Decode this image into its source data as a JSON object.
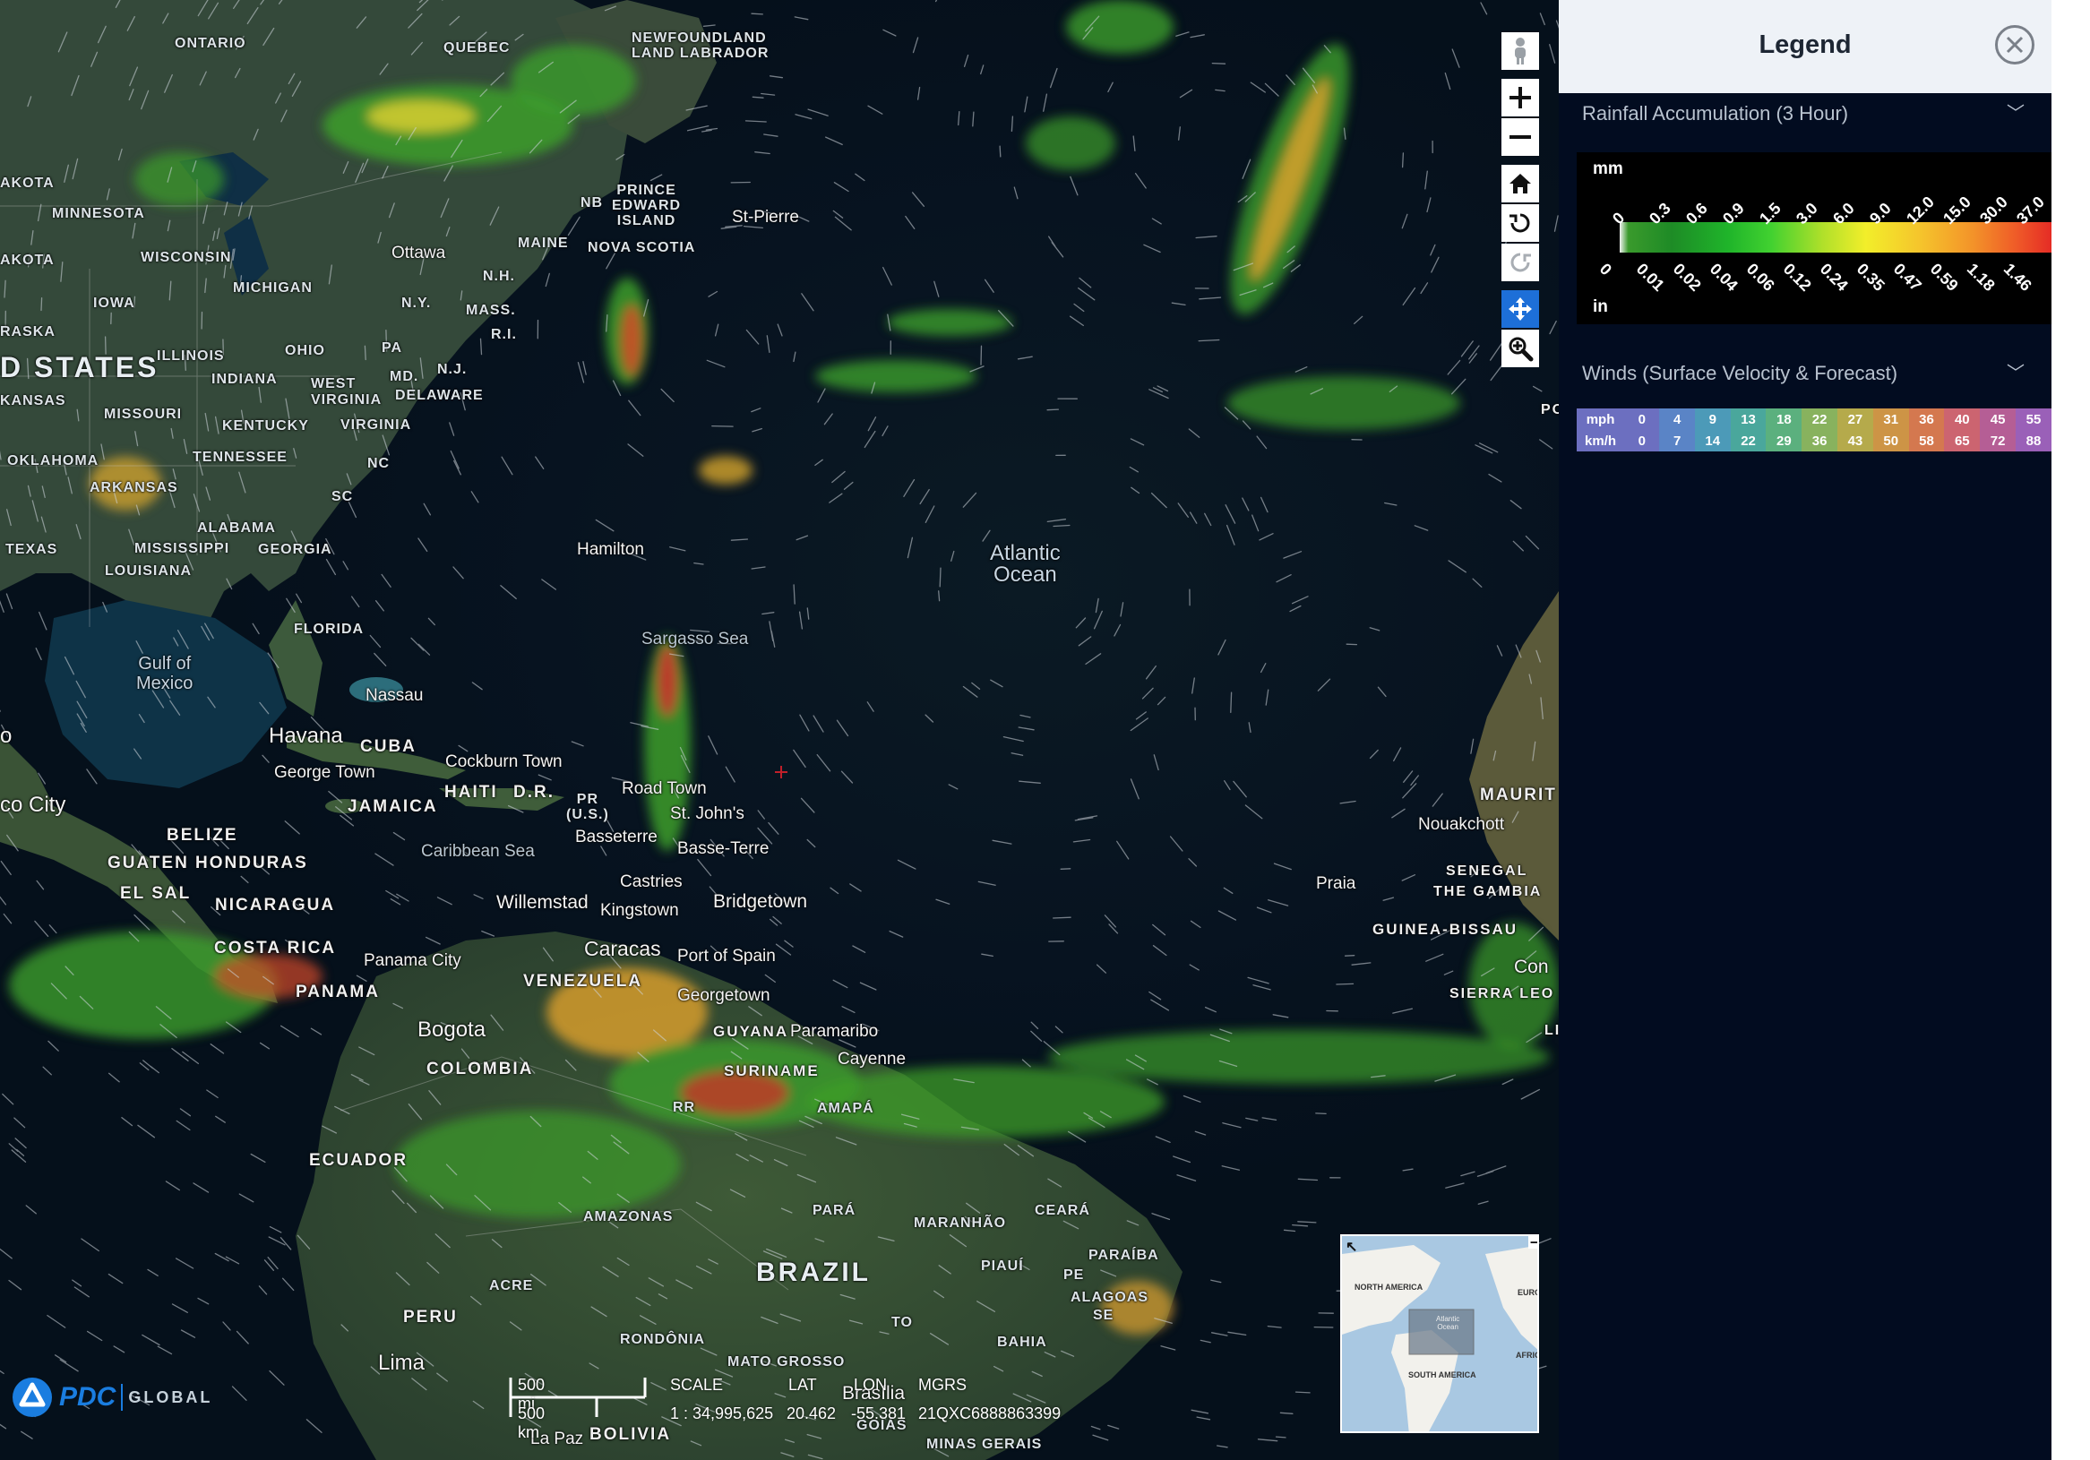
{
  "map": {
    "labels": {
      "ontario": "ONTARIO",
      "quebec": "QUEBEC",
      "newfoundland": "NEWFOUNDLAND\nLAND LABRADOR",
      "minnesota": "MINNESOTA",
      "dakota1": "AKOTA",
      "dakota2": "AKOTA",
      "wisconsin": "WISCONSIN",
      "michigan": "MICHIGAN",
      "iowa": "IOWA",
      "nebraska": "RASKA",
      "illinois": "ILLINOIS",
      "ohio": "OHIO",
      "pa": "PA",
      "ny": "N.Y.",
      "nh": "N.H.",
      "mass": "MASS.",
      "ri": "R.I.",
      "maine": "MAINE",
      "nb": "NB",
      "pei": "PRINCE\nEDWARD\nISLAND",
      "nova_scotia": "NOVA SCOTIA",
      "united_states": "D STATES",
      "kansas": "KANSAS",
      "missouri": "MISSOURI",
      "indiana": "INDIANA",
      "west_virginia": "WEST\nVIRGINIA",
      "md": "MD.",
      "nj": "N.J.",
      "delaware": "DELAWARE",
      "kentucky": "KENTUCKY",
      "virginia": "VIRGINIA",
      "oklahoma": "OKLAHOMA",
      "arkansas": "ARKANSAS",
      "tennessee": "TENNESSEE",
      "nc": "NC",
      "sc": "SC",
      "alabama": "ALABAMA",
      "mississippi": "MISSISSIPPI",
      "georgia": "GEORGIA",
      "texas": "TEXAS",
      "louisiana": "LOUISIANA",
      "florida": "FLORIDA",
      "cuba": "CUBA",
      "jamaica": "JAMAICA",
      "haiti": "HAITI",
      "dr": "D.R.",
      "pr": "PR\n(U.S.)",
      "belize": "BELIZE",
      "guatemala": "GUATEN",
      "honduras": "HONDURAS",
      "el_salvador": "EL SAL",
      "nicaragua": "NICARAGUA",
      "costa_rica": "COSTA RICA",
      "panama": "PANAMA",
      "venezuela": "VENEZUELA",
      "guyana": "GUYANA",
      "suriname": "SURINAME",
      "amapa": "AMAPÁ",
      "colombia": "COLOMBIA",
      "ecuador": "ECUADOR",
      "peru": "PERU",
      "brazil": "BRAZIL",
      "amazonas": "AMAZONAS",
      "rr": "RR",
      "para": "PARÁ",
      "maranhao": "MARANHÃO",
      "ceara": "CEARÁ",
      "piaui": "PIAUÍ",
      "paraiba": "PARAÍBA",
      "pe": "PE",
      "alagoas": "ALAGOAS",
      "se": "SE",
      "bahia": "BAHIA",
      "to": "TO",
      "acre": "ACRE",
      "rondonia": "RONDÔNIA",
      "mato_grosso": "MATO GROSSO",
      "goias": "GOIÁS",
      "minas_gerais": "MINAS GERAIS",
      "bolivia": "BOLIVIA",
      "mauritania": "MAURIT",
      "senegal": "SENEGAL",
      "gambia": "THE GAMBIA",
      "guinea_bissau": "GUINEA-BISSAU",
      "sierra_leone": "SIERRA LEO",
      "po": "PO",
      "li": "LI",
      "ottawa": "Ottawa",
      "st_pierre": "St-Pierre",
      "hamilton": "Hamilton",
      "nassau": "Nassau",
      "havana": "Havana",
      "george_town": "George Town",
      "cockburn_town": "Cockburn Town",
      "road_town": "Road Town",
      "st_johns": "St. John's",
      "basseterre": "Basseterre",
      "basse_terre": "Basse-Terre",
      "castries": "Castries",
      "willemstad": "Willemstad",
      "kingstown": "Kingstown",
      "bridgetown": "Bridgetown",
      "caracas": "Caracas",
      "port_of_spain": "Port of Spain",
      "georgetown": "Georgetown",
      "paramaribo": "Paramaribo",
      "cayenne": "Cayenne",
      "panama_city": "Panama City",
      "bogota": "Bogota",
      "lima": "Lima",
      "la_paz": "La Paz",
      "brasilia": "Brasília",
      "mexico_city": "co City",
      "nouakchott": "Nouakchott",
      "praia": "Praia",
      "conakry": "Con",
      "atlantic_ocean": "Atlantic\nOcean",
      "gulf_of_mexico": "Gulf of\nMexico",
      "caribbean_sea": "Caribbean Sea",
      "sargasso_sea": "Sargasso Sea",
      "o_edge": "o"
    },
    "minimap": {
      "north_america": "NORTH AMERICA",
      "south_america": "SOUTH AMERICA",
      "europe": "EUROP",
      "africa": "AFRIC",
      "atlantic": "Atlantic\nOcean"
    },
    "scalebar": {
      "top": "500 mi",
      "bottom": "500 km"
    },
    "coords": {
      "scale_label": "SCALE",
      "scale_value": "1 : 34,995,625",
      "lat_label": "LAT",
      "lat_value": "20.462",
      "lon_label": "LON",
      "lon_value": "-55.381",
      "mgrs_label": "MGRS",
      "mgrs_value": "21QXC6888863399"
    },
    "logo": {
      "brand": "PDC",
      "sub": "GLOBAL"
    }
  },
  "legend": {
    "title": "Legend",
    "rain": {
      "title": "Rainfall Accumulation (3 Hour)",
      "unit_top": "mm",
      "unit_bottom": "in",
      "mm_ticks": [
        "0",
        "0.3",
        "0.6",
        "0.9",
        "1.5",
        "3.0",
        "6.0",
        "9.0",
        "12.0",
        "15.0",
        "30.0",
        "37.0"
      ],
      "in_ticks": [
        "0",
        "0.01",
        "0.02",
        "0.04",
        "0.06",
        "0.12",
        "0.24",
        "0.35",
        "0.47",
        "0.59",
        "1.18",
        "1.46"
      ]
    },
    "wind": {
      "title": "Winds (Surface Velocity & Forecast)",
      "mph_label": "mph",
      "kmh_label": "km/h",
      "mph": [
        "0",
        "4",
        "9",
        "13",
        "18",
        "22",
        "27",
        "31",
        "36",
        "40",
        "45",
        "55"
      ],
      "kmh": [
        "0",
        "7",
        "14",
        "22",
        "29",
        "36",
        "43",
        "50",
        "58",
        "65",
        "72",
        "88"
      ],
      "colors": [
        "#6c6fc0",
        "#5a84c6",
        "#4c9ab8",
        "#4aa79c",
        "#5bb07e",
        "#88b25e",
        "#b5aa4b",
        "#cd9446",
        "#d4784f",
        "#cc6470",
        "#b55e95",
        "#9a60b8"
      ]
    }
  },
  "colors": {
    "panel_bg": "#020c20",
    "header_bg": "#eef2f7",
    "accent": "#1d6fd8"
  }
}
